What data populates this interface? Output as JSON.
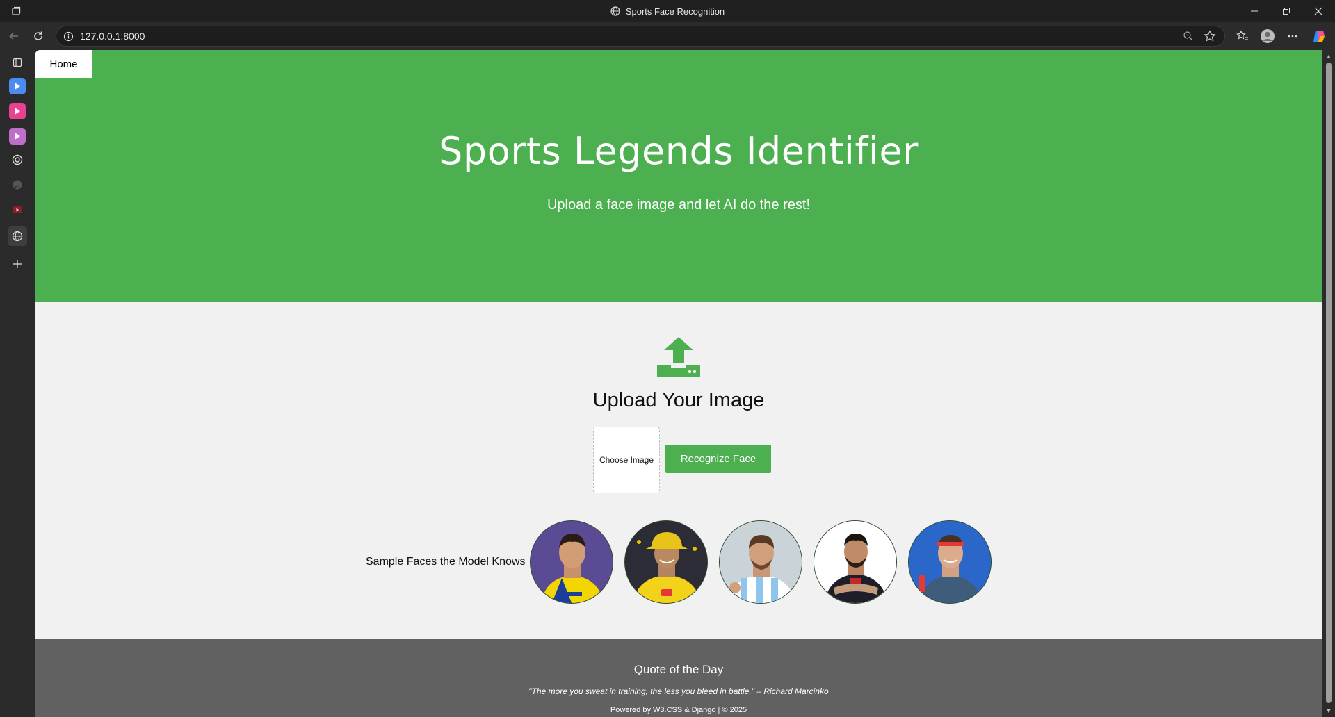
{
  "window": {
    "title": "Sports Face Recognition"
  },
  "addressbar": {
    "url": "127.0.0.1:8000"
  },
  "navbar": {
    "home_label": "Home"
  },
  "hero": {
    "title": "Sports Legends Identifier",
    "subtitle": "Upload a face image and let AI do the rest!"
  },
  "upload": {
    "title": "Upload Your Image",
    "choose_label": "Choose Image",
    "recognize_label": "Recognize Face"
  },
  "samples": {
    "label": "Sample Faces the Model Knows",
    "faces": [
      {
        "icon": "portrait-yellow-blue-jersey"
      },
      {
        "icon": "portrait-yellow-jersey-cap"
      },
      {
        "icon": "portrait-white-blue-stripes"
      },
      {
        "icon": "portrait-dark-red-jersey"
      },
      {
        "icon": "portrait-blue-background-headband"
      }
    ]
  },
  "footer": {
    "quote_title": "Quote of the Day",
    "quote_text": "\"The more you sweat in training, the less you bleed in battle.\" – Richard Marcinko",
    "powered": "Powered by W3.CSS & Django | © 2025"
  },
  "colors": {
    "accent": "#4caf50",
    "footer": "#616161",
    "page_bg": "#f1f1f1"
  }
}
